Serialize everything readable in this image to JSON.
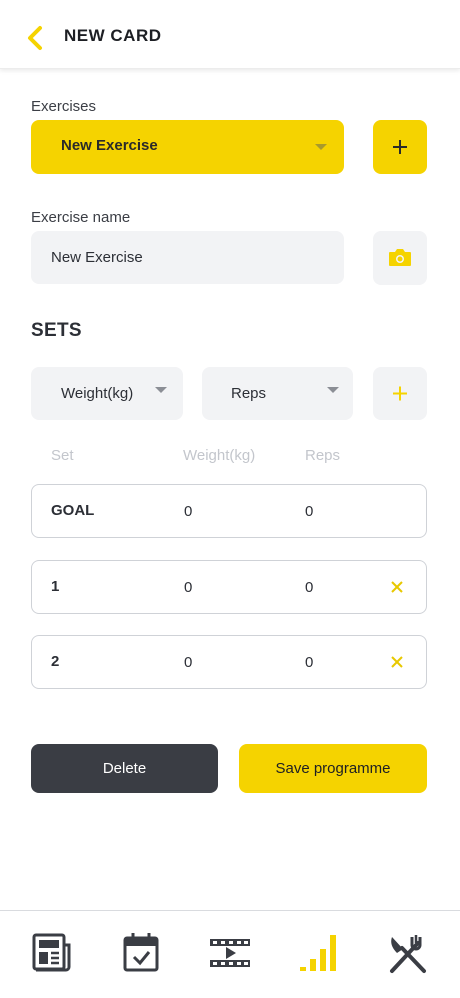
{
  "header": {
    "title": "NEW CARD"
  },
  "exercises": {
    "label": "Exercises",
    "selected": "New Exercise"
  },
  "exercise_name": {
    "label": "Exercise name",
    "value": "New Exercise"
  },
  "sets": {
    "title": "SETS",
    "dropdown_weight": "Weight(kg)",
    "dropdown_reps": "Reps",
    "columns": [
      "Set",
      "Weight(kg)",
      "Reps"
    ],
    "rows": [
      {
        "set": "GOAL",
        "weight": "0",
        "reps": "0"
      },
      {
        "set": "1",
        "weight": "0",
        "reps": "0"
      },
      {
        "set": "2",
        "weight": "0",
        "reps": "0"
      }
    ]
  },
  "actions": {
    "delete": "Delete",
    "save": "Save programme"
  },
  "colors": {
    "accent": "#f5d300",
    "dark": "#3a3d44",
    "field": "#f2f3f5"
  },
  "nav": {
    "items": [
      {
        "icon": "news-icon",
        "active": false
      },
      {
        "icon": "calendar-check-icon",
        "active": false
      },
      {
        "icon": "video-icon",
        "active": false
      },
      {
        "icon": "bar-chart-icon",
        "active": true
      },
      {
        "icon": "utensils-icon",
        "active": false
      }
    ]
  }
}
